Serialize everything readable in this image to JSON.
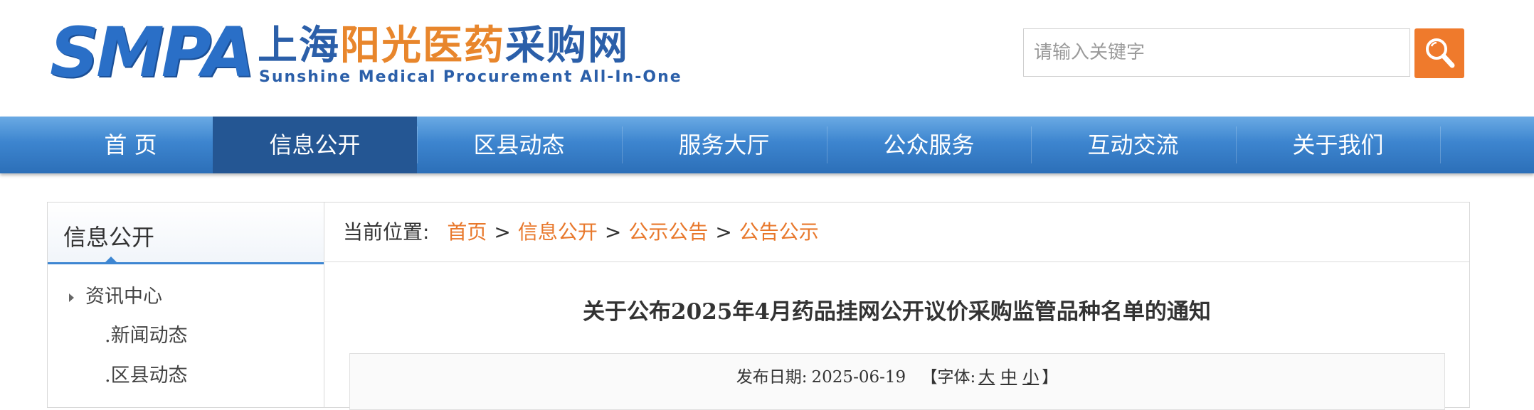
{
  "header": {
    "logo_mark": "SMPA",
    "logo_cn_part1": "上海",
    "logo_cn_part2": "阳光医药",
    "logo_cn_part3": "采购网",
    "logo_en": "Sunshine Medical Procurement All-In-One",
    "search_placeholder": "请输入关键字",
    "accent_color": "#ef7a2c",
    "search_icon": "search-icon"
  },
  "nav": {
    "items": [
      "首 页",
      "信息公开",
      "区县动态",
      "服务大厅",
      "公众服务",
      "互动交流",
      "关于我们"
    ],
    "active_index": 1
  },
  "sidebar": {
    "title": "信息公开",
    "category": "资讯中心",
    "subitems": [
      ".新闻动态",
      ".区县动态"
    ]
  },
  "breadcrumb": {
    "label": "当前位置:",
    "items": [
      "首页",
      "信息公开",
      "公示公告",
      "公告公示"
    ],
    "separator": ">"
  },
  "article": {
    "title": "关于公布2025年4月药品挂网公开议价采购监管品种名单的通知",
    "date_label": "发布日期:",
    "date": "2025-06-19",
    "font_label_open": "【字体:",
    "font_large": "大",
    "font_medium": "中",
    "font_small": "小",
    "font_label_close": "】"
  }
}
